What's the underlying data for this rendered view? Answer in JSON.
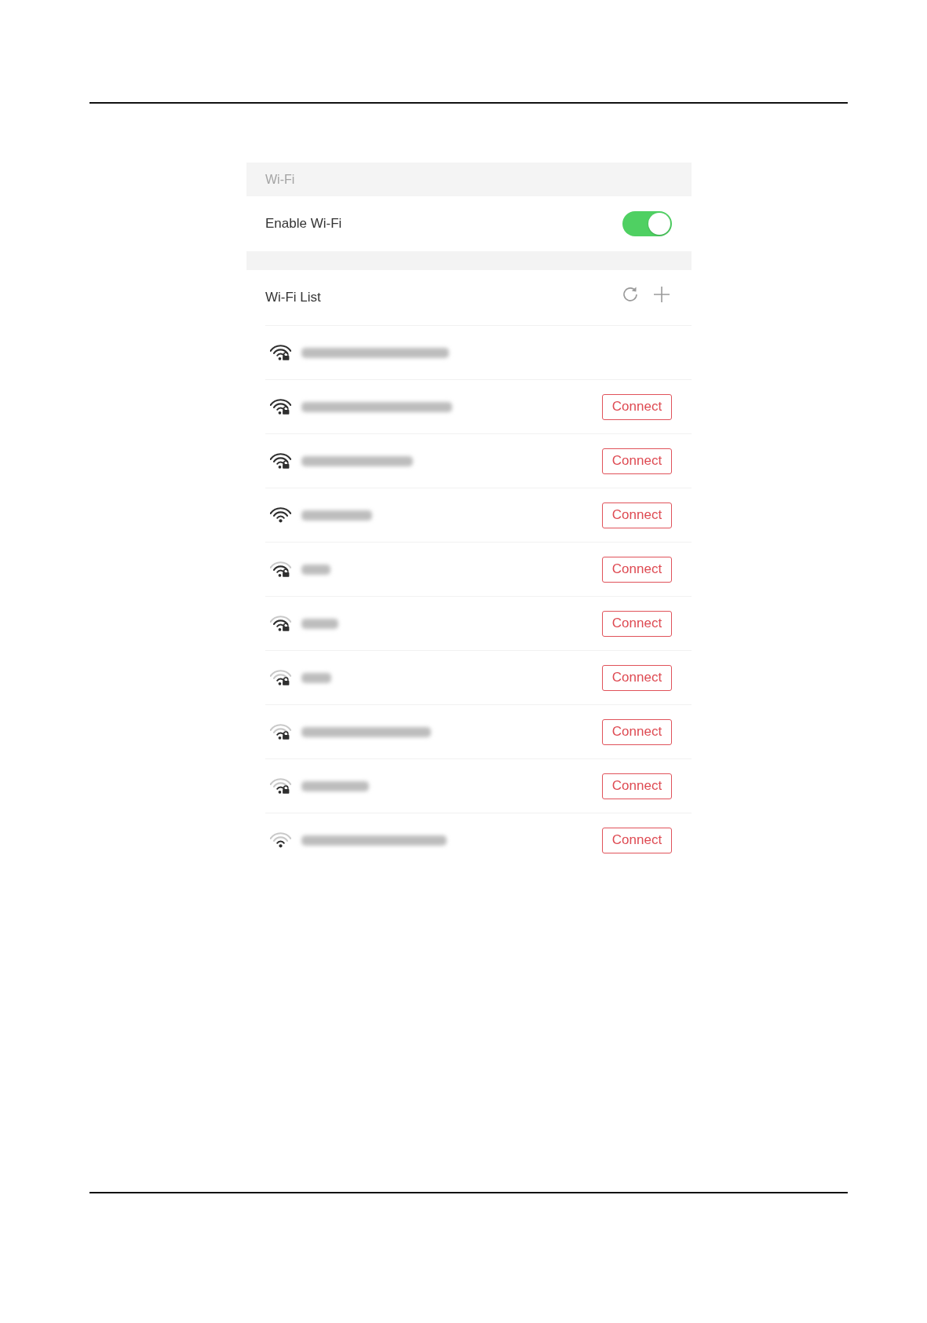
{
  "section_header": {
    "title": "Wi-Fi"
  },
  "enable_row": {
    "label": "Enable Wi-Fi",
    "on": true
  },
  "wifi_list": {
    "title": "Wi-Fi List",
    "networks": [
      {
        "kind": "strong",
        "secured": true
      },
      {
        "kind": "strong",
        "secured": true,
        "button": "Connect"
      },
      {
        "kind": "strong",
        "secured": true,
        "button": "Connect"
      },
      {
        "kind": "strong",
        "secured": false,
        "button": "Connect"
      },
      {
        "kind": "medium",
        "secured": true,
        "button": "Connect"
      },
      {
        "kind": "medium",
        "secured": true,
        "button": "Connect"
      },
      {
        "kind": "weak",
        "secured": true,
        "button": "Connect"
      },
      {
        "kind": "weak",
        "secured": true,
        "button": "Connect"
      },
      {
        "kind": "weak",
        "secured": true,
        "button": "Connect"
      },
      {
        "kind": "weak",
        "secured": false,
        "button": "Connect"
      }
    ]
  }
}
